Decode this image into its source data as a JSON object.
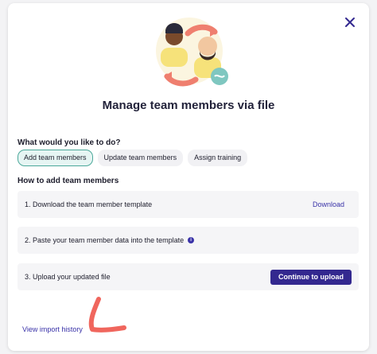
{
  "modal": {
    "title": "Manage team members via file",
    "question": "What would you like to do?",
    "options": [
      {
        "label": "Add team members",
        "selected": true
      },
      {
        "label": "Update team members",
        "selected": false
      },
      {
        "label": "Assign training",
        "selected": false
      }
    ],
    "how_label": "How to add team members",
    "steps": [
      {
        "text": "1. Download the team member template",
        "action": "Download"
      },
      {
        "text": "2. Paste your team member data into the template",
        "info_icon": "info-icon"
      },
      {
        "text": "3. Upload your updated file",
        "action": "Continue to upload"
      }
    ],
    "view_history": "View import history",
    "close_icon": "close-icon"
  },
  "colors": {
    "accent": "#33288f",
    "link": "#3a33a8",
    "selected_border": "#4ba89a",
    "selected_bg": "#e6f5f3",
    "annotation": "#f0665d"
  }
}
